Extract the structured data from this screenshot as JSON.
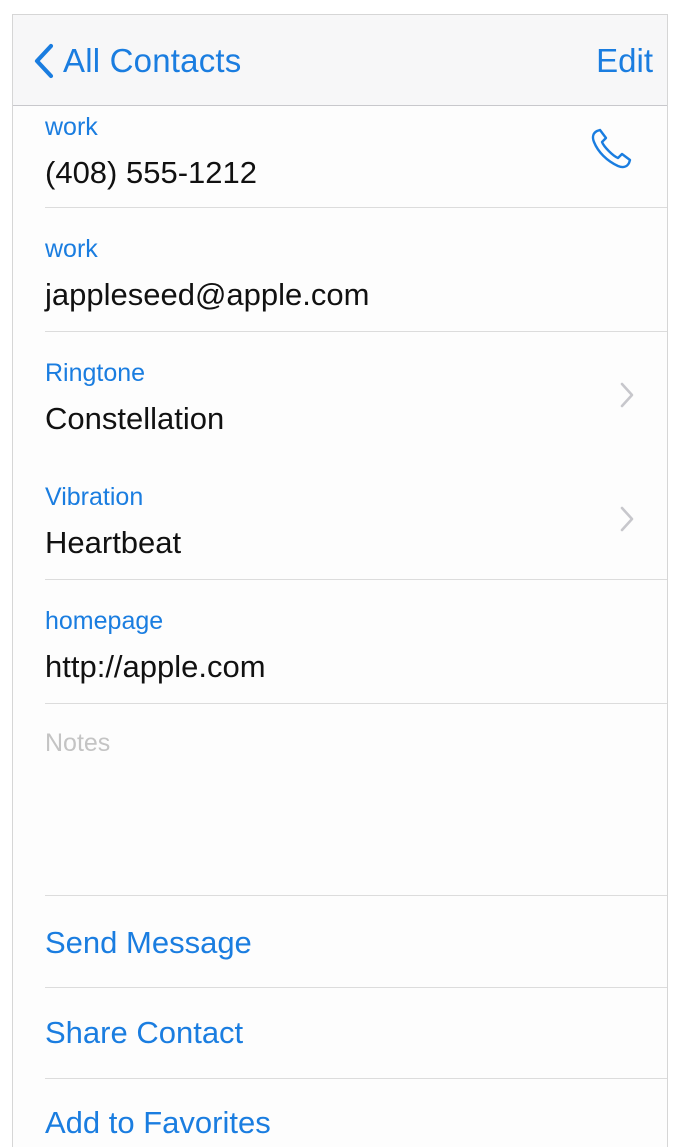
{
  "navbar": {
    "back_label": "All Contacts",
    "edit_label": "Edit"
  },
  "fields": [
    {
      "label": "work",
      "value": "(408) 555-1212",
      "accessory": "phone-icon"
    },
    {
      "label": "work",
      "value": "jappleseed@apple.com",
      "accessory": ""
    },
    {
      "label": "Ringtone",
      "value": "Constellation",
      "accessory": "chevron-right-icon"
    },
    {
      "label": "Vibration",
      "value": "Heartbeat",
      "accessory": "chevron-right-icon"
    },
    {
      "label": "homepage",
      "value": "http://apple.com",
      "accessory": ""
    }
  ],
  "notes": {
    "label": "Notes"
  },
  "actions": [
    {
      "label": "Send Message"
    },
    {
      "label": "Share Contact"
    },
    {
      "label": "Add to Favorites"
    }
  ],
  "colors": {
    "accent": "#1a7de0",
    "text": "#111111",
    "placeholder": "#c4c4c4",
    "separator": "#dcdcdc",
    "navbar": "#f7f7f8"
  }
}
